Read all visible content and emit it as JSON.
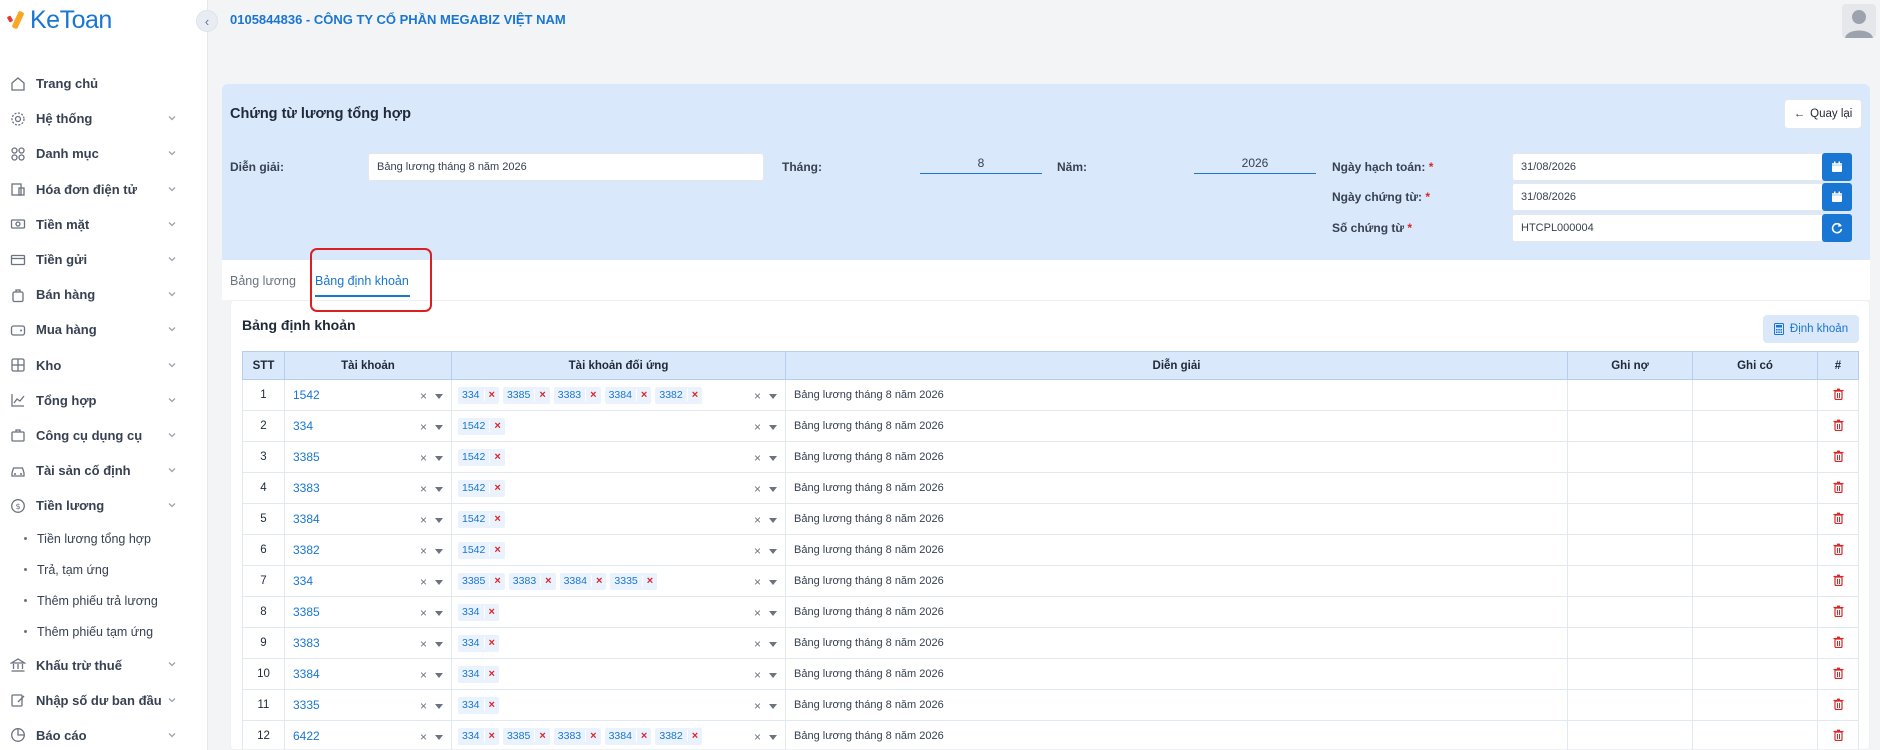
{
  "app": {
    "name": "KeToan"
  },
  "header": {
    "company": "0105844836 - CÔNG TY CỔ PHẦN MEGABIZ VIỆT NAM"
  },
  "sidebar": {
    "items": [
      {
        "label": "Trang chủ",
        "icon": "home-icon"
      },
      {
        "label": "Hệ thống",
        "icon": "gear-icon"
      },
      {
        "label": "Danh mục",
        "icon": "grid-icon"
      },
      {
        "label": "Hóa đơn điện tử",
        "icon": "invoice-icon"
      },
      {
        "label": "Tiền mặt",
        "icon": "cash-icon"
      },
      {
        "label": "Tiền gửi",
        "icon": "card-icon"
      },
      {
        "label": "Bán hàng",
        "icon": "bag-icon"
      },
      {
        "label": "Mua hàng",
        "icon": "wallet-icon"
      },
      {
        "label": "Kho",
        "icon": "warehouse-icon"
      },
      {
        "label": "Tổng hợp",
        "icon": "chart-icon"
      },
      {
        "label": "Công cụ dụng cụ",
        "icon": "tools-icon"
      },
      {
        "label": "Tài sản cố định",
        "icon": "car-icon"
      },
      {
        "label": "Tiền lương",
        "icon": "dollar-icon"
      }
    ],
    "sub_items": [
      "Tiền lương tổng hợp",
      "Trả, tạm ứng",
      "Thêm phiếu trả lương",
      "Thêm phiếu tạm ứng"
    ],
    "items_after": [
      {
        "label": "Khấu trừ thuế",
        "icon": "bank-icon"
      },
      {
        "label": "Nhập số dư ban đầu",
        "icon": "edit-icon"
      },
      {
        "label": "Báo cáo",
        "icon": "report-icon"
      }
    ]
  },
  "form": {
    "title": "Chứng từ lương tổng hợp",
    "back_label": "Quay lại",
    "dien_giai_label": "Diễn giải:",
    "dien_giai_value": "Bảng lương tháng 8 năm 2026",
    "thang_label": "Tháng:",
    "thang_value": "8",
    "nam_label": "Năm:",
    "nam_value": "2026",
    "ngay_hach_toan_label": "Ngày hạch toán:",
    "ngay_hach_toan_value": "31/08/2026",
    "ngay_chung_tu_label": "Ngày chứng từ:",
    "ngay_chung_tu_value": "31/08/2026",
    "so_chung_tu_label": "Số chứng từ",
    "so_chung_tu_value": "HTCPL000004",
    "required_mark": "*"
  },
  "tabs": [
    {
      "label": "Bảng lương",
      "active": false
    },
    {
      "label": "Bảng định khoản",
      "active": true
    }
  ],
  "table_card": {
    "title": "Bảng định khoản",
    "dinh_khoan_button": "Định khoản",
    "columns": [
      "STT",
      "Tài khoản",
      "Tài khoản đối ứng",
      "Diễn giải",
      "Ghi nợ",
      "Ghi có",
      "#"
    ],
    "rows": [
      {
        "stt": "1",
        "account": "1542",
        "counter": [
          "334",
          "3385",
          "3383",
          "3384",
          "3382"
        ],
        "desc": "Bảng lương tháng 8 năm 2026"
      },
      {
        "stt": "2",
        "account": "334",
        "counter": [
          "1542"
        ],
        "desc": "Bảng lương tháng 8 năm 2026"
      },
      {
        "stt": "3",
        "account": "3385",
        "counter": [
          "1542"
        ],
        "desc": "Bảng lương tháng 8 năm 2026"
      },
      {
        "stt": "4",
        "account": "3383",
        "counter": [
          "1542"
        ],
        "desc": "Bảng lương tháng 8 năm 2026"
      },
      {
        "stt": "5",
        "account": "3384",
        "counter": [
          "1542"
        ],
        "desc": "Bảng lương tháng 8 năm 2026"
      },
      {
        "stt": "6",
        "account": "3382",
        "counter": [
          "1542"
        ],
        "desc": "Bảng lương tháng 8 năm 2026"
      },
      {
        "stt": "7",
        "account": "334",
        "counter": [
          "3385",
          "3383",
          "3384",
          "3335"
        ],
        "desc": "Bảng lương tháng 8 năm 2026"
      },
      {
        "stt": "8",
        "account": "3385",
        "counter": [
          "334"
        ],
        "desc": "Bảng lương tháng 8 năm 2026"
      },
      {
        "stt": "9",
        "account": "3383",
        "counter": [
          "334"
        ],
        "desc": "Bảng lương tháng 8 năm 2026"
      },
      {
        "stt": "10",
        "account": "3384",
        "counter": [
          "334"
        ],
        "desc": "Bảng lương tháng 8 năm 2026"
      },
      {
        "stt": "11",
        "account": "3335",
        "counter": [
          "334"
        ],
        "desc": "Bảng lương tháng 8 năm 2026"
      },
      {
        "stt": "12",
        "account": "6422",
        "counter": [
          "334",
          "3385",
          "3383",
          "3384",
          "3382"
        ],
        "desc": "Bảng lương tháng 8 năm 2026"
      }
    ]
  },
  "colors": {
    "accent": "#1976d2",
    "panel": "#d9e8fb",
    "danger": "#dc2626"
  }
}
